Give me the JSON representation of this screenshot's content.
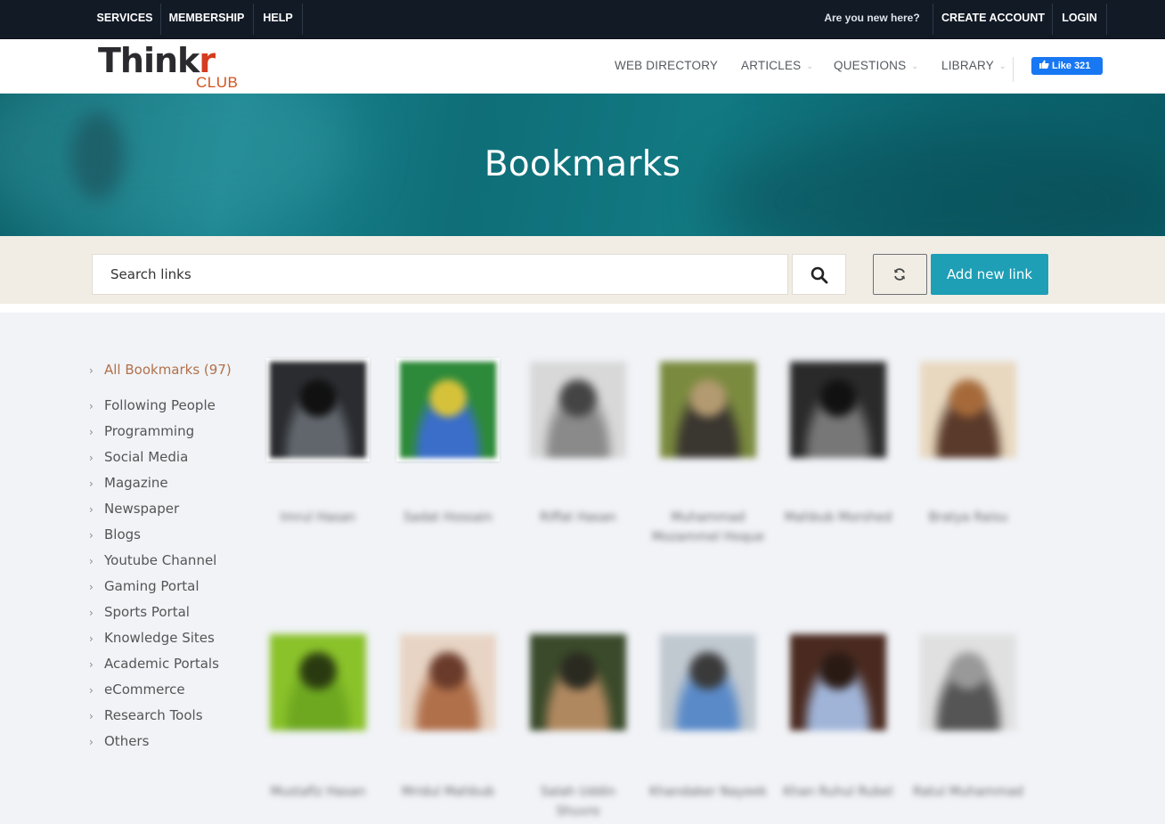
{
  "topbar": {
    "services": "SERVICES",
    "membership": "MEMBERSHIP",
    "help": "HELP",
    "new_here": "Are you new here?",
    "create_account": "CREATE ACCOUNT",
    "login": "LOGIN"
  },
  "header": {
    "logo_main": "Think",
    "logo_r": "r",
    "logo_club": "CLUB",
    "nav": {
      "web_directory": "WEB DIRECTORY",
      "articles": "ARTICLES",
      "questions": "QUESTIONS",
      "library": "LIBRARY"
    },
    "fb_like": "Like 321"
  },
  "hero": {
    "title": "Bookmarks"
  },
  "search": {
    "placeholder": "Search links",
    "add_label": "Add new link",
    "search_icon": "search-icon",
    "refresh_icon": "refresh-icon"
  },
  "sidebar": {
    "items": [
      {
        "label": "All Bookmarks (97)",
        "active": true
      },
      {
        "label": "Following People"
      },
      {
        "label": "Programming"
      },
      {
        "label": "Social Media"
      },
      {
        "label": "Magazine"
      },
      {
        "label": "Newspaper"
      },
      {
        "label": "Blogs"
      },
      {
        "label": "Youtube Channel"
      },
      {
        "label": "Gaming Portal"
      },
      {
        "label": "Sports Portal"
      },
      {
        "label": "Knowledge Sites"
      },
      {
        "label": "Academic Portals"
      },
      {
        "label": "eCommerce"
      },
      {
        "label": "Research Tools"
      },
      {
        "label": "Others"
      }
    ]
  },
  "people": [
    {
      "name": "Imrul Hasan",
      "colors": [
        "#2a2c30",
        "#60666c",
        "#111"
      ]
    },
    {
      "name": "Sadat Hossain",
      "colors": [
        "#2d8a3a",
        "#3a6ec8",
        "#d6c23a"
      ]
    },
    {
      "name": "Riffat Hasan",
      "colors": [
        "#d8d8d8",
        "#8a8a8a",
        "#444"
      ]
    },
    {
      "name": "Muhammad Mozammel Hoque",
      "colors": [
        "#7a8a3e",
        "#3a3630",
        "#b39a70"
      ]
    },
    {
      "name": "Mahbub Morshed",
      "colors": [
        "#2a2a2a",
        "#777",
        "#111"
      ]
    },
    {
      "name": "Bratya Raisu",
      "colors": [
        "#e8d8c0",
        "#5a3a2a",
        "#a66a3a"
      ]
    },
    {
      "name": "Mustafiz Hasan",
      "colors": [
        "#8ac22a",
        "#6ea820",
        "#2a3a10"
      ]
    },
    {
      "name": "Mridul Mahbub",
      "colors": [
        "#e8d4c4",
        "#b0704a",
        "#6a3a2a"
      ]
    },
    {
      "name": "Salah Uddin Shuvro",
      "colors": [
        "#3a4a2a",
        "#b08860",
        "#2a2a20"
      ]
    },
    {
      "name": "Khandaker Nayeek",
      "colors": [
        "#c0c8d0",
        "#5a8ac8",
        "#3a3a3a"
      ]
    },
    {
      "name": "Khan Ruhul Rubel",
      "colors": [
        "#4a2a20",
        "#a0b4d8",
        "#2a1a14"
      ]
    },
    {
      "name": "Ratul Muhammad",
      "colors": [
        "#e0e0e0",
        "#555",
        "#999"
      ]
    }
  ]
}
